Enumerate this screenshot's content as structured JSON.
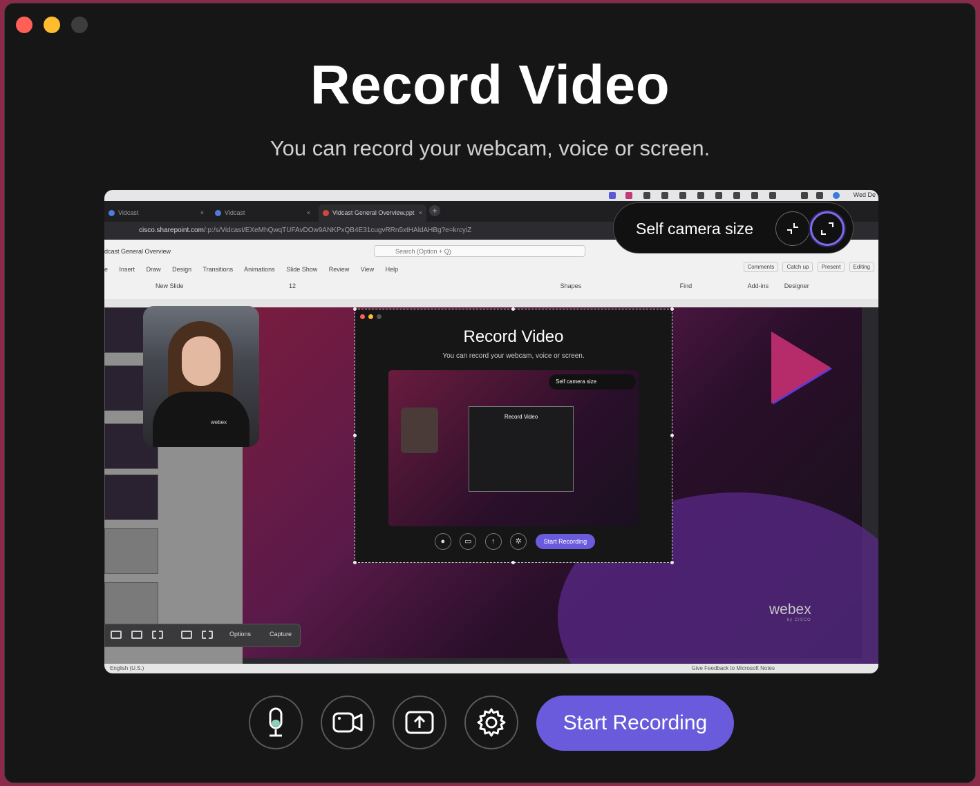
{
  "header": {
    "title": "Record Video",
    "subtitle": "You can record your webcam, voice or screen."
  },
  "preview": {
    "menubar_clock": "Wed De",
    "tabs": [
      {
        "label": "Vidcast",
        "active": false
      },
      {
        "label": "Vidcast",
        "active": false
      },
      {
        "label": "Vidcast General Overview.ppt",
        "active": true
      }
    ],
    "url_host": "cisco.sharepoint.com",
    "url_path": "/:p:/s/Vidcast/EXeMhQwqTUFAvDOw9ANKPxQB4E31cugvRRn5xtHAldAHBg?e=krcyiZ",
    "doc_title": "dcast General Overview",
    "search_placeholder": "Search (Option + Q)",
    "menus": [
      "e",
      "Insert",
      "Draw",
      "Design",
      "Transitions",
      "Animations",
      "Slide Show",
      "Review",
      "View",
      "Help"
    ],
    "ribbon_buttons": [
      "Comments",
      "Catch up",
      "Present",
      "Editing"
    ],
    "tools": [
      "New Slide",
      "12",
      "Shapes",
      "Find",
      "Add-ins",
      "Designer"
    ],
    "status_lang": "English (U.S.)",
    "status_feedback": "Give Feedback to Microsoft   Notes",
    "brand": "webex",
    "brand_sub": "by CISCO",
    "webcam_badge": "webex",
    "capture_options": "Options",
    "capture_button": "Capture",
    "nested_title": "Record Video",
    "nested_subtitle": "You can record your webcam, voice or screen.",
    "nested_pill": "Self camera size",
    "nested_inner_title": "Record Video",
    "nested_record": "Start Recording"
  },
  "camera_size": {
    "label": "Self camera size",
    "shrink_icon": "collapse-icon",
    "expand_icon": "expand-icon",
    "selected": "expand"
  },
  "controls": {
    "mic": "microphone-icon",
    "camera": "camera-icon",
    "screen": "screen-share-icon",
    "settings": "gear-icon",
    "record_label": "Start Recording"
  },
  "colors": {
    "accent": "#6a5bdc",
    "background": "#161616",
    "close": "#fe5f57",
    "minimize": "#febc2e",
    "selected_ring": "#7b6bf0"
  }
}
